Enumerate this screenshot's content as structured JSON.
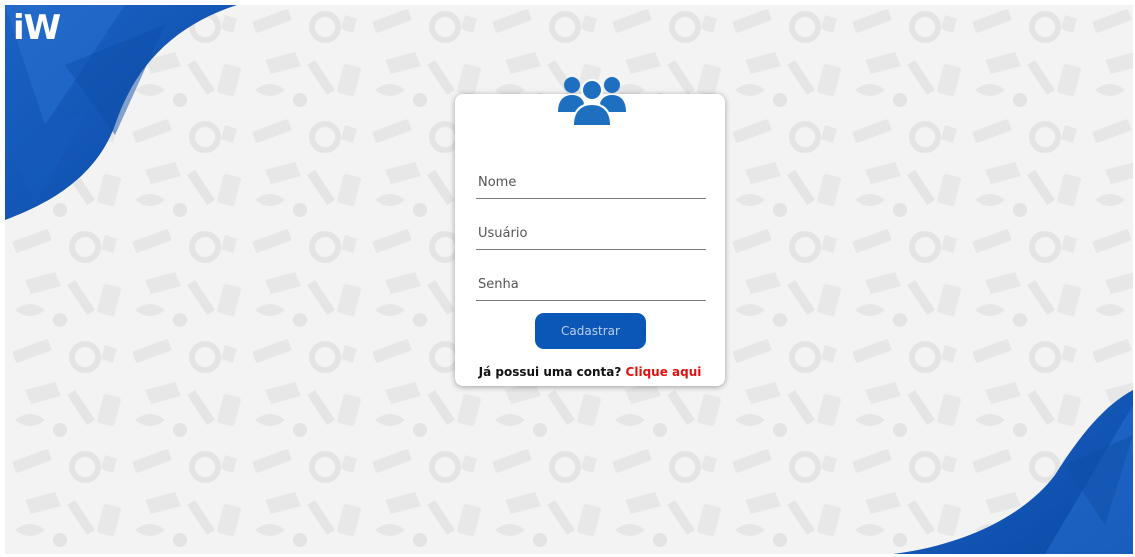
{
  "brand": {
    "logo_text": "iW",
    "accent_color": "#0b57b8",
    "link_color": "#e01010"
  },
  "form": {
    "header_icon": "users-icon",
    "fields": [
      {
        "placeholder": "Nome",
        "value": ""
      },
      {
        "placeholder": "Usuário",
        "value": ""
      },
      {
        "placeholder": "Senha",
        "value": ""
      }
    ],
    "submit_label": "Cadastrar",
    "login_prompt": "Já possui uma conta?",
    "login_link": "Clique aqui"
  }
}
